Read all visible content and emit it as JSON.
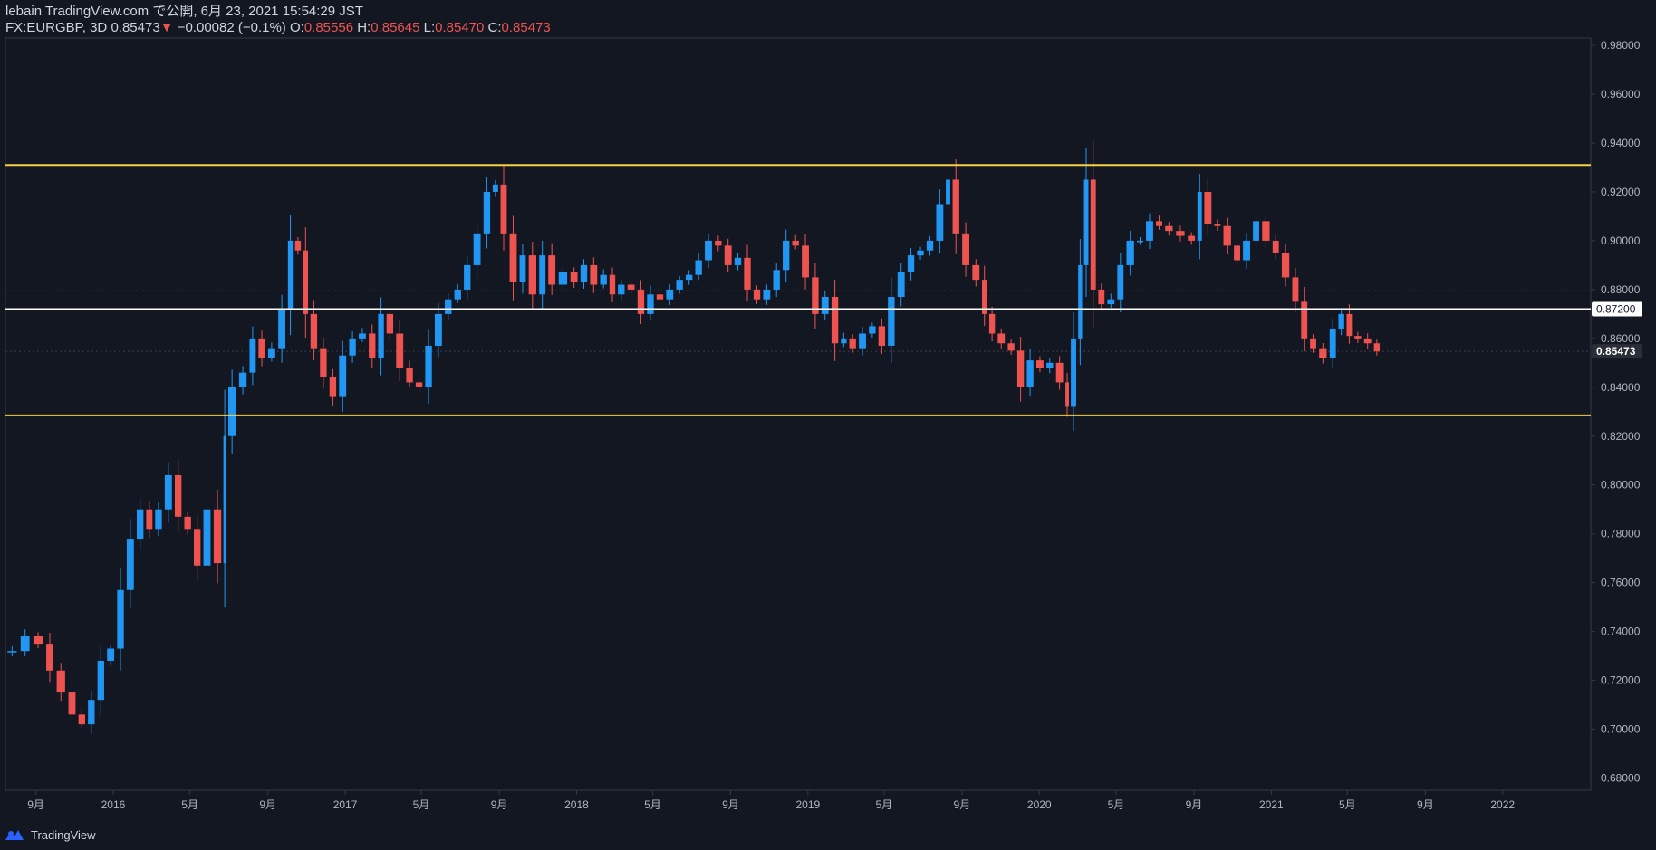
{
  "header": {
    "line1": "lebain TradingView.com で公開, 6月 23, 2021 15:54:29 JST",
    "symbol": "FX:EURGBP, 3D",
    "last": "0.85473",
    "arrow": "▼",
    "change": "−0.00082 (−0.1%)",
    "o_label": "O:",
    "o_value": "0.85556",
    "h_label": "H:",
    "h_value": "0.85645",
    "l_label": "L:",
    "l_value": "0.85470",
    "c_label": "C:",
    "c_value": "0.85473"
  },
  "footer": {
    "brand": "TradingView",
    "logo_icon": "tradingview-logo-icon"
  },
  "colors": {
    "background": "#131722",
    "up": "#2196f3",
    "down": "#ef5350",
    "support_resistance": "#f5d142",
    "level": "#ffffff",
    "axis_text": "#b2b5be",
    "border": "#363a45"
  },
  "chart_data": {
    "type": "line",
    "style": "candlestick",
    "ylim": [
      0.675,
      0.983
    ],
    "x_range": [
      "2015-07-15",
      "2022-05-20"
    ],
    "y_ticks": [
      "0.98000",
      "0.96000",
      "0.94000",
      "0.92000",
      "0.90000",
      "0.88000",
      "0.86000",
      "0.84000",
      "0.82000",
      "0.80000",
      "0.78000",
      "0.76000",
      "0.74000",
      "0.72000",
      "0.70000",
      "0.68000"
    ],
    "x_ticks": [
      {
        "date": "2015-09-01",
        "label": "9月"
      },
      {
        "date": "2016-01-01",
        "label": "2016"
      },
      {
        "date": "2016-05-01",
        "label": "5月"
      },
      {
        "date": "2016-09-01",
        "label": "9月"
      },
      {
        "date": "2017-01-01",
        "label": "2017"
      },
      {
        "date": "2017-05-01",
        "label": "5月"
      },
      {
        "date": "2017-09-01",
        "label": "9月"
      },
      {
        "date": "2018-01-01",
        "label": "2018"
      },
      {
        "date": "2018-05-01",
        "label": "5月"
      },
      {
        "date": "2018-09-01",
        "label": "9月"
      },
      {
        "date": "2019-01-01",
        "label": "2019"
      },
      {
        "date": "2019-05-01",
        "label": "5月"
      },
      {
        "date": "2019-09-01",
        "label": "9月"
      },
      {
        "date": "2020-01-01",
        "label": "2020"
      },
      {
        "date": "2020-05-01",
        "label": "5月"
      },
      {
        "date": "2020-09-01",
        "label": "9月"
      },
      {
        "date": "2021-01-01",
        "label": "2021"
      },
      {
        "date": "2021-05-01",
        "label": "5月"
      },
      {
        "date": "2021-09-01",
        "label": "9月"
      },
      {
        "date": "2022-01-01",
        "label": "2022"
      }
    ],
    "horizontal_lines": [
      {
        "value": 0.931,
        "color": "#f5d142",
        "name": "resistance"
      },
      {
        "value": 0.872,
        "color": "#ffffff",
        "name": "level",
        "label": "0.87200"
      },
      {
        "value": 0.8285,
        "color": "#f5d142",
        "name": "support"
      }
    ],
    "dotted_line": {
      "value": 0.8795
    },
    "last_price": {
      "value": 0.85473,
      "label": "0.85473"
    },
    "series": [
      {
        "values": [
          [
            "2015-07-15",
            0.732
          ],
          [
            "2015-08-05",
            0.732
          ],
          [
            "2015-08-25",
            0.738
          ],
          [
            "2015-09-15",
            0.735
          ],
          [
            "2015-10-01",
            0.724
          ],
          [
            "2015-10-20",
            0.715
          ],
          [
            "2015-11-05",
            0.706
          ],
          [
            "2015-11-20",
            0.702
          ],
          [
            "2015-12-05",
            0.712
          ],
          [
            "2015-12-20",
            0.728
          ],
          [
            "2016-01-05",
            0.733
          ],
          [
            "2016-01-20",
            0.757
          ],
          [
            "2016-02-05",
            0.778
          ],
          [
            "2016-02-20",
            0.79
          ],
          [
            "2016-03-05",
            0.782
          ],
          [
            "2016-03-20",
            0.79
          ],
          [
            "2016-04-05",
            0.804
          ],
          [
            "2016-04-20",
            0.787
          ],
          [
            "2016-05-05",
            0.782
          ],
          [
            "2016-05-20",
            0.767
          ],
          [
            "2016-06-05",
            0.79
          ],
          [
            "2016-06-22",
            0.768
          ],
          [
            "2016-06-28",
            0.82
          ],
          [
            "2016-07-15",
            0.84
          ],
          [
            "2016-08-01",
            0.846
          ],
          [
            "2016-08-15",
            0.86
          ],
          [
            "2016-08-30",
            0.852
          ],
          [
            "2016-09-15",
            0.856
          ],
          [
            "2016-10-01",
            0.872
          ],
          [
            "2016-10-12",
            0.9
          ],
          [
            "2016-10-25",
            0.896
          ],
          [
            "2016-11-05",
            0.87
          ],
          [
            "2016-11-20",
            0.856
          ],
          [
            "2016-12-05",
            0.844
          ],
          [
            "2016-12-20",
            0.836
          ],
          [
            "2017-01-05",
            0.853
          ],
          [
            "2017-01-20",
            0.86
          ],
          [
            "2017-02-05",
            0.862
          ],
          [
            "2017-02-20",
            0.852
          ],
          [
            "2017-03-05",
            0.87
          ],
          [
            "2017-03-20",
            0.862
          ],
          [
            "2017-04-05",
            0.848
          ],
          [
            "2017-04-20",
            0.842
          ],
          [
            "2017-05-05",
            0.84
          ],
          [
            "2017-05-20",
            0.857
          ],
          [
            "2017-06-05",
            0.87
          ],
          [
            "2017-06-20",
            0.876
          ],
          [
            "2017-07-05",
            0.88
          ],
          [
            "2017-07-20",
            0.89
          ],
          [
            "2017-08-05",
            0.903
          ],
          [
            "2017-08-20",
            0.92
          ],
          [
            "2017-09-01",
            0.923
          ],
          [
            "2017-09-15",
            0.903
          ],
          [
            "2017-10-01",
            0.883
          ],
          [
            "2017-10-15",
            0.894
          ],
          [
            "2017-11-01",
            0.878
          ],
          [
            "2017-11-15",
            0.894
          ],
          [
            "2017-12-01",
            0.882
          ],
          [
            "2017-12-20",
            0.887
          ],
          [
            "2018-01-05",
            0.883
          ],
          [
            "2018-01-20",
            0.89
          ],
          [
            "2018-02-05",
            0.882
          ],
          [
            "2018-02-20",
            0.886
          ],
          [
            "2018-03-05",
            0.878
          ],
          [
            "2018-03-20",
            0.882
          ],
          [
            "2018-04-05",
            0.88
          ],
          [
            "2018-04-20",
            0.87
          ],
          [
            "2018-05-05",
            0.878
          ],
          [
            "2018-05-20",
            0.876
          ],
          [
            "2018-06-05",
            0.88
          ],
          [
            "2018-06-20",
            0.884
          ],
          [
            "2018-07-05",
            0.886
          ],
          [
            "2018-07-20",
            0.892
          ],
          [
            "2018-08-05",
            0.9
          ],
          [
            "2018-08-20",
            0.898
          ],
          [
            "2018-09-05",
            0.89
          ],
          [
            "2018-09-20",
            0.893
          ],
          [
            "2018-10-05",
            0.88
          ],
          [
            "2018-10-20",
            0.876
          ],
          [
            "2018-11-05",
            0.88
          ],
          [
            "2018-11-20",
            0.888
          ],
          [
            "2018-12-05",
            0.9
          ],
          [
            "2018-12-20",
            0.898
          ],
          [
            "2019-01-05",
            0.885
          ],
          [
            "2019-01-20",
            0.87
          ],
          [
            "2019-02-05",
            0.877
          ],
          [
            "2019-02-20",
            0.858
          ],
          [
            "2019-03-05",
            0.86
          ],
          [
            "2019-03-20",
            0.856
          ],
          [
            "2019-04-05",
            0.862
          ],
          [
            "2019-04-20",
            0.865
          ],
          [
            "2019-05-05",
            0.857
          ],
          [
            "2019-05-20",
            0.877
          ],
          [
            "2019-06-05",
            0.887
          ],
          [
            "2019-06-20",
            0.894
          ],
          [
            "2019-07-05",
            0.896
          ],
          [
            "2019-07-20",
            0.9
          ],
          [
            "2019-08-05",
            0.915
          ],
          [
            "2019-08-15",
            0.925
          ],
          [
            "2019-08-30",
            0.903
          ],
          [
            "2019-09-15",
            0.89
          ],
          [
            "2019-10-01",
            0.884
          ],
          [
            "2019-10-12",
            0.87
          ],
          [
            "2019-10-25",
            0.862
          ],
          [
            "2019-11-10",
            0.858
          ],
          [
            "2019-11-25",
            0.855
          ],
          [
            "2019-12-10",
            0.84
          ],
          [
            "2019-12-25",
            0.851
          ],
          [
            "2020-01-10",
            0.848
          ],
          [
            "2020-01-25",
            0.85
          ],
          [
            "2020-02-10",
            0.842
          ],
          [
            "2020-02-18",
            0.832
          ],
          [
            "2020-03-01",
            0.86
          ],
          [
            "2020-03-10",
            0.89
          ],
          [
            "2020-03-20",
            0.925
          ],
          [
            "2020-04-01",
            0.88
          ],
          [
            "2020-04-15",
            0.874
          ],
          [
            "2020-05-01",
            0.876
          ],
          [
            "2020-05-15",
            0.89
          ],
          [
            "2020-06-01",
            0.9
          ],
          [
            "2020-06-15",
            0.9
          ],
          [
            "2020-07-01",
            0.908
          ],
          [
            "2020-07-15",
            0.906
          ],
          [
            "2020-08-01",
            0.904
          ],
          [
            "2020-08-20",
            0.902
          ],
          [
            "2020-09-05",
            0.9
          ],
          [
            "2020-09-15",
            0.92
          ],
          [
            "2020-10-01",
            0.907
          ],
          [
            "2020-10-15",
            0.906
          ],
          [
            "2020-11-01",
            0.898
          ],
          [
            "2020-11-15",
            0.892
          ],
          [
            "2020-12-01",
            0.9
          ],
          [
            "2020-12-15",
            0.908
          ],
          [
            "2021-01-01",
            0.9
          ],
          [
            "2021-01-15",
            0.895
          ],
          [
            "2021-02-01",
            0.885
          ],
          [
            "2021-02-15",
            0.875
          ],
          [
            "2021-03-01",
            0.86
          ],
          [
            "2021-03-15",
            0.856
          ],
          [
            "2021-04-01",
            0.852
          ],
          [
            "2021-04-15",
            0.864
          ],
          [
            "2021-04-28",
            0.87
          ],
          [
            "2021-05-10",
            0.861
          ],
          [
            "2021-05-25",
            0.86
          ],
          [
            "2021-06-10",
            0.858
          ],
          [
            "2021-06-23",
            0.8547
          ]
        ]
      }
    ]
  }
}
